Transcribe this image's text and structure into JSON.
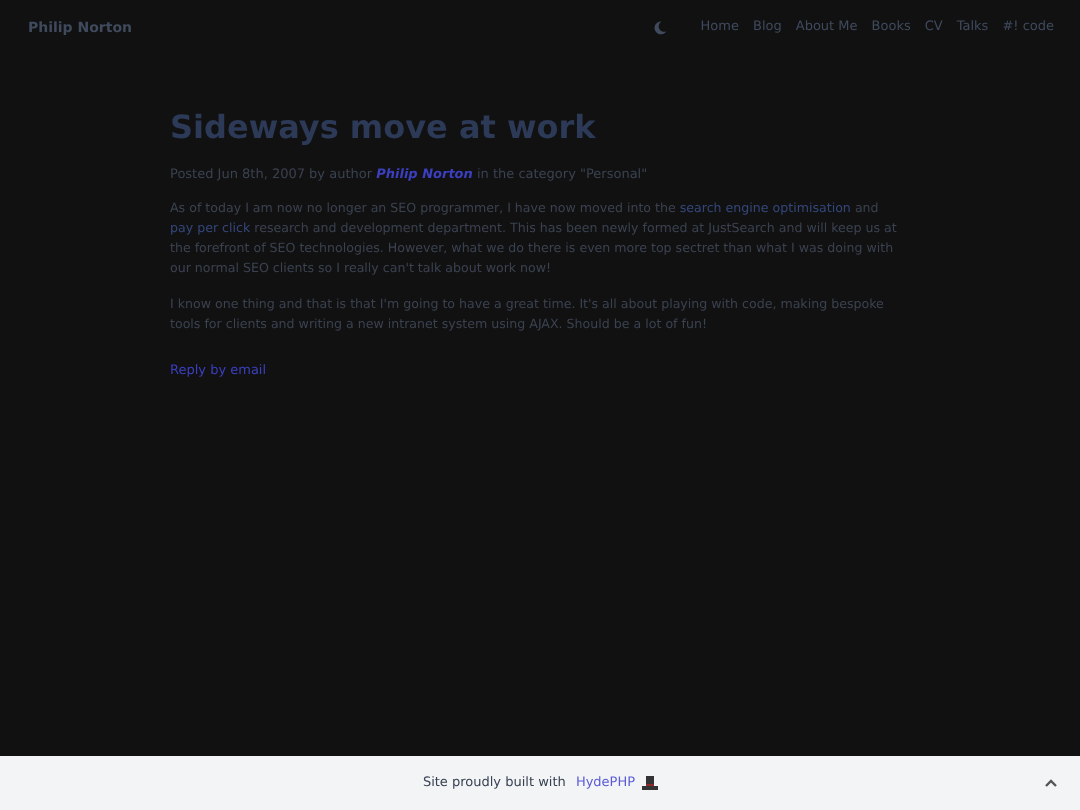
{
  "header": {
    "site_name": "Philip Norton",
    "nav": [
      {
        "label": "Home"
      },
      {
        "label": "Blog"
      },
      {
        "label": "About Me"
      },
      {
        "label": "Books"
      },
      {
        "label": "CV"
      },
      {
        "label": "Talks"
      },
      {
        "label": "#! code"
      }
    ]
  },
  "post": {
    "title": "Sideways move at work",
    "meta": {
      "prefix": "Posted Jun 8th, 2007 by author ",
      "author": "Philip Norton",
      "suffix": " in the category \"Personal\""
    },
    "paragraphs": [
      [
        {
          "text": "As of today I am now no longer an SEO programmer, I have now moved into the "
        },
        {
          "link": "search engine optimisation"
        },
        {
          "text": " and "
        },
        {
          "link": "pay per click"
        },
        {
          "text": " research and development department. This has been newly formed at JustSearch and will keep us at the forefront of SEO technologies. However, what we do there is even more top sectret than what I was doing with our normal SEO clients so I really can't talk about work now!"
        }
      ],
      [
        {
          "text": "I know one thing and that is that I'm going to have a great time. It's all about playing with code, making bespoke tools for clients and writing a new intranet system using AJAX. Should be a lot of fun!"
        }
      ]
    ],
    "reply_link": "Reply by email"
  },
  "footer": {
    "text": "Site proudly built with ",
    "link": "HydePHP"
  }
}
